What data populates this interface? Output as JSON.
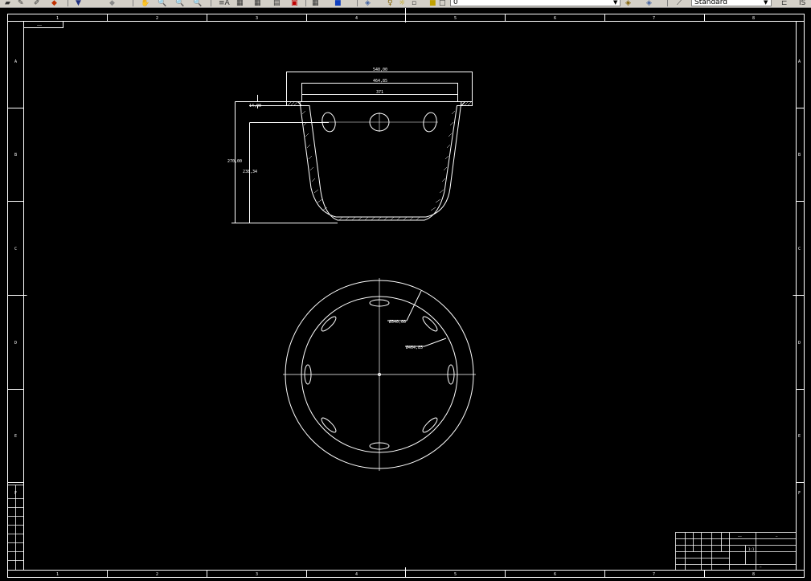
{
  "toolbar": {
    "icons": [
      "open-icon",
      "pen-icon",
      "paint-icon",
      "arrow-down-icon",
      "zoom-icon",
      "zoom-realtime-icon",
      "zoom-window-icon",
      "zoom-prev-icon",
      "text-style-icon",
      "properties-icon",
      "design-center-icon",
      "tool-palette-icon",
      "table-icon",
      "help-icon",
      "layer-icon",
      "bulb-icon",
      "sun-icon",
      "lock-icon",
      "color-icon",
      "layer-states-icon",
      "layer-prev-icon",
      "dimstyle-icon"
    ],
    "layer_value": "0",
    "style_value": "Standard",
    "right_cut_text": "IS"
  },
  "drawing": {
    "column_labels": [
      "1",
      "2",
      "3",
      "4",
      "5",
      "6",
      "7",
      "8"
    ],
    "row_labels": [
      "A",
      "B",
      "C",
      "D",
      "E",
      "F"
    ],
    "corner_box_text": "——",
    "side_view": {
      "dim_top_outer": "540,00",
      "dim_top_inner": "464,85",
      "dim_top_bottom": "371",
      "dim_flange": "14,00",
      "dim_height_total": "270,00",
      "dim_height_inner": "238,34"
    },
    "top_view": {
      "dim_outer_dia": "Ø540,00",
      "dim_inner_dia": "Ø464,85"
    },
    "title_block": {
      "name_cell": "——",
      "sheet_cell": "—",
      "scale_cell": "1:1",
      "material_cell": "—"
    }
  }
}
